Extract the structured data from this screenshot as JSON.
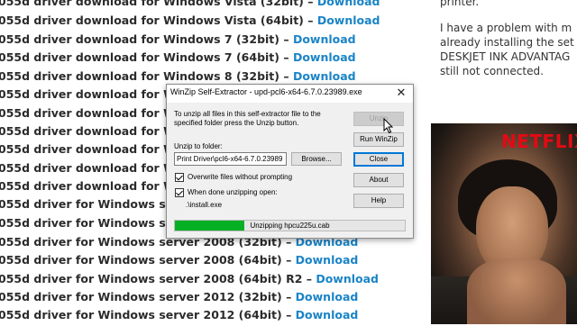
{
  "page": {
    "rows": [
      {
        "text": "055d driver download for Windows Vista (32bit) – ",
        "link": "Download"
      },
      {
        "text": "055d driver download for Windows Vista (64bit) – ",
        "link": "Download"
      },
      {
        "text": "055d driver download for Windows 7 (32bit) – ",
        "link": "Download"
      },
      {
        "text": "055d driver download for Windows 7 (64bit) – ",
        "link": "Download"
      },
      {
        "text": "055d driver download for Windows 8 (32bit) – ",
        "link": "Download"
      },
      {
        "text": "055d driver download for Windo",
        "link": ""
      },
      {
        "text": "055d driver download for Windo",
        "link": ""
      },
      {
        "text": "055d driver download for Windo",
        "link": ""
      },
      {
        "text": "055d driver download for Windo",
        "link": ""
      },
      {
        "text": "055d driver download for Windo",
        "link": ""
      },
      {
        "text": "055d driver download for Windo",
        "link": ""
      },
      {
        "text": "055d driver for Windows server 2",
        "link": ""
      },
      {
        "text": "055d driver for Windows server 2",
        "link": ""
      },
      {
        "text": "055d driver for Windows server 2008 (32bit) – ",
        "link": "Download"
      },
      {
        "text": "055d driver for Windows server 2008 (64bit) – ",
        "link": "Download"
      },
      {
        "text": "055d driver for Windows server 2008 (64bit) R2 – ",
        "link": "Download"
      },
      {
        "text": "055d driver for Windows server 2012 (32bit) – ",
        "link": "Download"
      },
      {
        "text": "055d driver for Windows server 2012 (64bit) – ",
        "link": "Download"
      }
    ],
    "right_column": [
      "printer.",
      "I have a problem with m",
      "already installing the set",
      "DESKJET INK ADVANTAG",
      "still not connected."
    ],
    "video_badge": "NETFLIX"
  },
  "dialog": {
    "title": "WinZip Self-Extractor - upd-pcl6-x64-6.7.0.23989.exe",
    "description": "To unzip all files in this self-extractor file to the specified folder press the Unzip button.",
    "unzip_to_label": "Unzip to folder:",
    "folder_value": "Print Driver\\pcl6-x64-6.7.0.23989",
    "browse_label": "Browse...",
    "overwrite_label": "Overwrite files without prompting",
    "overwrite_checked": true,
    "when_done_label": "When done unzipping open:",
    "when_done_checked": true,
    "open_value": ".\\install.exe",
    "buttons": {
      "unzip": "Unzip",
      "run_winzip": "Run WinZip",
      "close": "Close",
      "about": "About",
      "help": "Help"
    },
    "progress_text": "Unzipping hpcu225u.cab",
    "progress_percent": 30,
    "progress_color": "#06b025"
  },
  "icons": {
    "close": "close-icon",
    "cursor": "mouse-pointer-icon"
  }
}
